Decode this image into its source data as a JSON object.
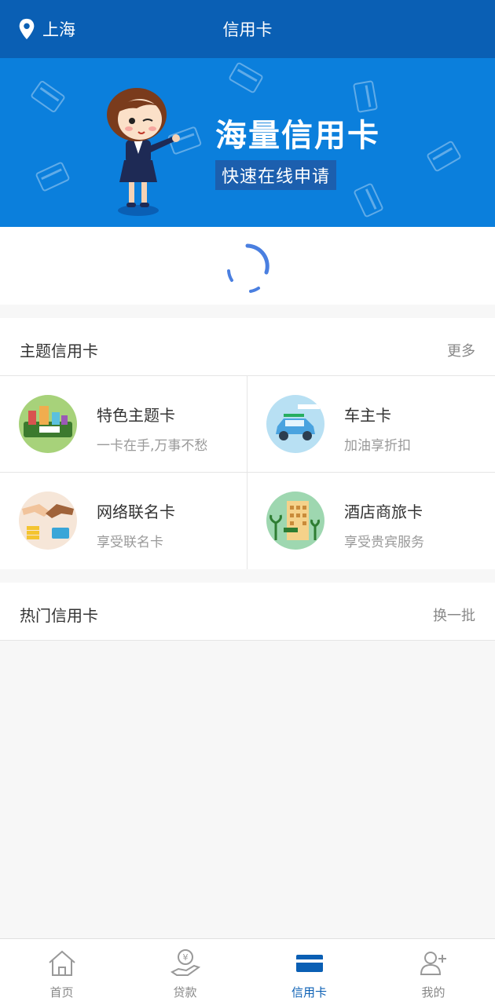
{
  "header": {
    "location": "上海",
    "title": "信用卡",
    "location_icon": "location-pin-icon"
  },
  "banner": {
    "headline": "海量信用卡",
    "subheadline": "快速在线申请"
  },
  "theme_section": {
    "title": "主题信用卡",
    "action": "更多",
    "cards": [
      {
        "name": "特色主题卡",
        "desc": "一卡在手,万事不愁",
        "icon": "city-card-icon"
      },
      {
        "name": "车主卡",
        "desc": "加油享折扣",
        "icon": "car-icon"
      },
      {
        "name": "网络联名卡",
        "desc": "享受联名卡",
        "icon": "handshake-icon"
      },
      {
        "name": "酒店商旅卡",
        "desc": "享受贵宾服务",
        "icon": "hotel-icon"
      }
    ]
  },
  "hot_section": {
    "title": "热门信用卡",
    "action": "换一批"
  },
  "tabs": [
    {
      "label": "首页",
      "icon": "home-icon",
      "active": false
    },
    {
      "label": "贷款",
      "icon": "loan-hand-icon",
      "active": false
    },
    {
      "label": "信用卡",
      "icon": "credit-card-icon",
      "active": true
    },
    {
      "label": "我的",
      "icon": "user-add-icon",
      "active": false
    }
  ],
  "colors": {
    "header_bg": "#0a5fb4",
    "banner_bg": "#0b7fdc",
    "accent": "#0a5fb4"
  }
}
